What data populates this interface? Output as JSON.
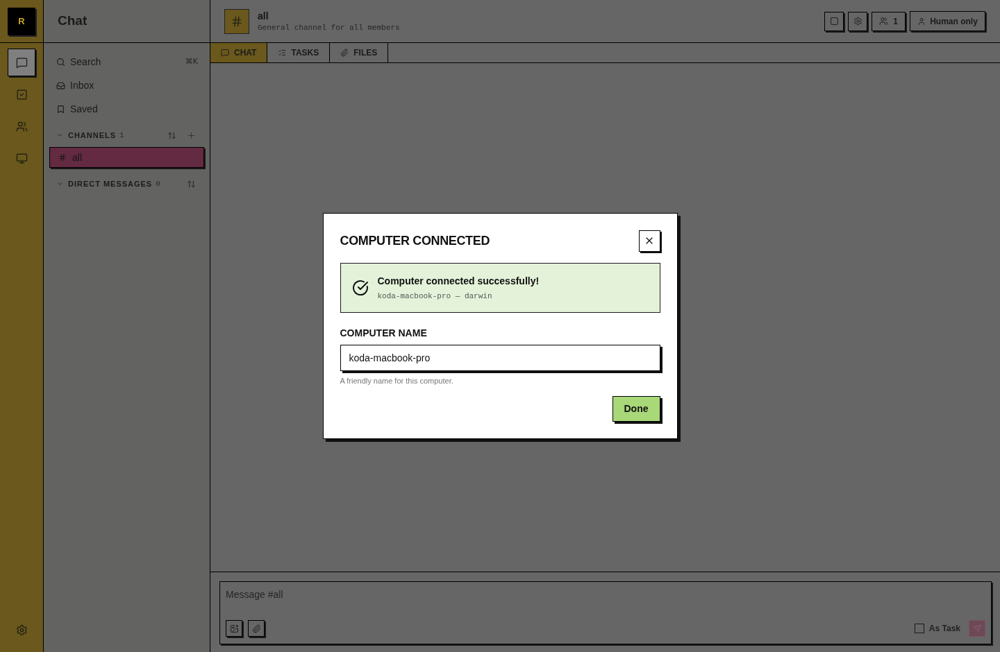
{
  "rail": {
    "logo": "R",
    "nav": [
      {
        "kind": "chat",
        "selected": true
      },
      {
        "kind": "tasks",
        "selected": false
      },
      {
        "kind": "people",
        "selected": false
      },
      {
        "kind": "computers",
        "selected": false
      }
    ]
  },
  "sidebar": {
    "title": "Chat",
    "items": [
      {
        "kind": "search",
        "label": "Search",
        "shortcut": "⌘K"
      },
      {
        "kind": "inbox",
        "label": "Inbox"
      },
      {
        "kind": "saved",
        "label": "Saved"
      }
    ],
    "sections": [
      {
        "kind": "channels",
        "label": "CHANNELS",
        "count": "1",
        "expanded": true,
        "items": [
          {
            "name": "all",
            "selected": true
          }
        ]
      },
      {
        "kind": "direct",
        "label": "DIRECT MESSAGES",
        "count": "0",
        "expanded": true
      }
    ]
  },
  "header": {
    "channel": "all",
    "description": "General channel for all members",
    "actions": [
      {
        "kind": "layout"
      },
      {
        "kind": "settings"
      },
      {
        "kind": "members",
        "label": "1"
      },
      {
        "kind": "mode",
        "label": "Human only"
      }
    ]
  },
  "tabs": [
    {
      "kind": "chat",
      "label": "CHAT",
      "selected": true
    },
    {
      "kind": "tasks",
      "label": "TASKS",
      "selected": false
    },
    {
      "kind": "files",
      "label": "FILES",
      "selected": false
    }
  ],
  "composer": {
    "placeholder": "Message #all",
    "as_task": {
      "label": "As Task",
      "checked": false
    }
  },
  "dialog": {
    "title": "COMPUTER CONNECTED",
    "success": {
      "title": "Computer connected successfully!",
      "detail": "koda-macbook-pro — darwin"
    },
    "field": {
      "label": "COMPUTER NAME",
      "value": "koda-macbook-pro",
      "help_text": "A friendly name for this computer."
    },
    "button": "Done"
  }
}
